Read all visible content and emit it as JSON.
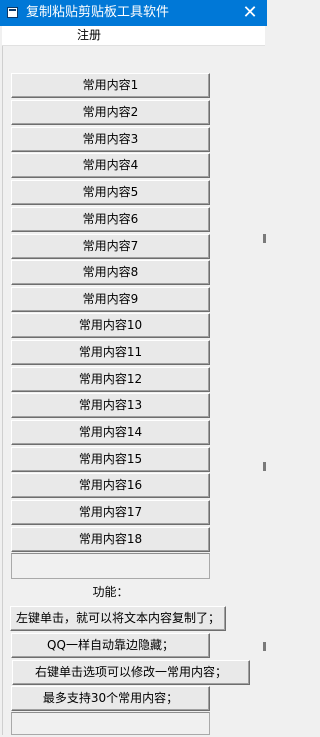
{
  "window": {
    "title": "复制粘贴剪贴板工具软件",
    "close_glyph": "✕"
  },
  "menu": {
    "register": "注册"
  },
  "content_buttons": [
    "常用内容1",
    "常用内容2",
    "常用内容3",
    "常用内容4",
    "常用内容5",
    "常用内容6",
    "常用内容7",
    "常用内容8",
    "常用内容9",
    "常用内容10",
    "常用内容11",
    "常用内容12",
    "常用内容13",
    "常用内容14",
    "常用内容15",
    "常用内容16",
    "常用内容17",
    "常用内容18"
  ],
  "features": {
    "heading": "功能：",
    "items": [
      "左键单击，就可以将文本内容复制了；",
      "QQ一样自动靠边隐藏；",
      "右键单击选项可以修改一常用内容；",
      "最多支持30个常用内容；"
    ]
  }
}
